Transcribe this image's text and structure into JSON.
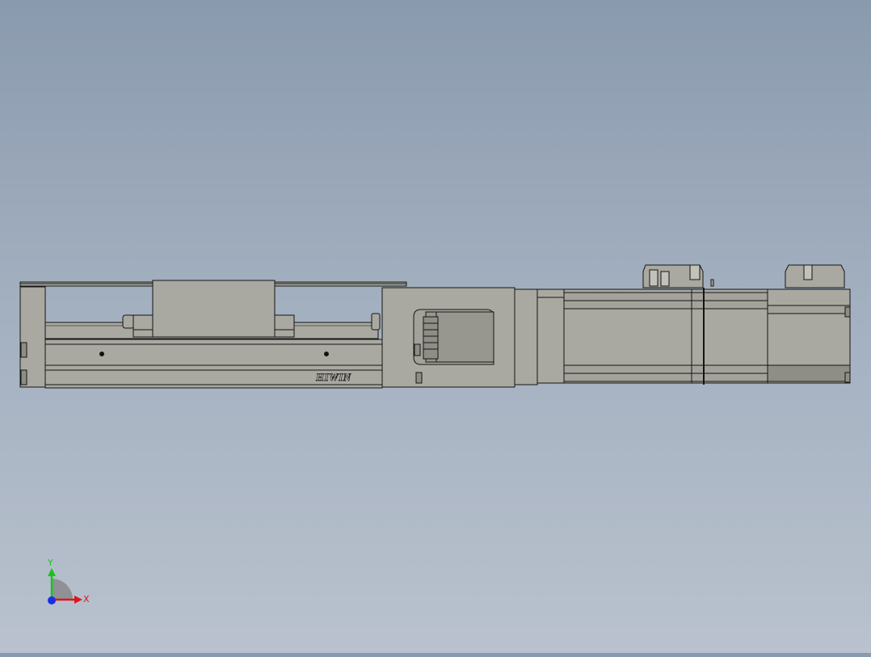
{
  "viewport": {
    "brand_label": "HIWIN",
    "view_orientation": "front"
  },
  "triad": {
    "x_label": "X",
    "y_label": "Y",
    "x_color": "#e0141e",
    "y_color": "#18c41c",
    "z_color": "#1a2ee6"
  },
  "colors": {
    "part_fill": "#a9a9a1",
    "part_fill_dark": "#8e8e86",
    "edge": "#151515"
  }
}
